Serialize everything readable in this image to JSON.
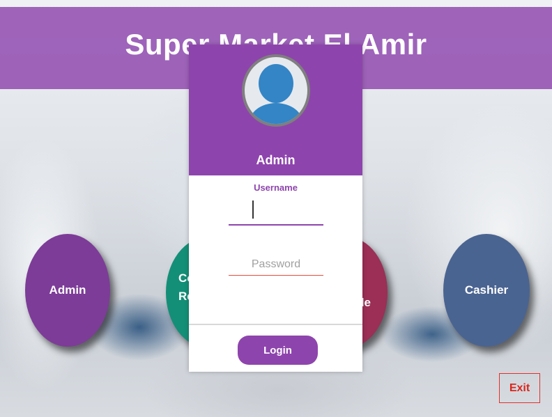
{
  "app": {
    "title": "Super Market El Amir"
  },
  "roles": [
    {
      "label_line1": "Admin",
      "label_line2": ""
    },
    {
      "label_line1": "Co",
      "label_line2": "Re"
    },
    {
      "label_line1": "",
      "label_line2": "le"
    },
    {
      "label_line1": "Cashier",
      "label_line2": ""
    }
  ],
  "login_card": {
    "role_title": "Admin",
    "username_label": "Username",
    "username_value": "",
    "password_placeholder": "Password",
    "login_label": "Login"
  },
  "footer": {
    "exit_label": "Exit"
  },
  "colors": {
    "accent": "#8e44ad",
    "admin": "#7d3c98",
    "commercial": "#148f77",
    "sale": "#9b2f55",
    "cashier": "#4a6491",
    "exit": "#d9261c"
  },
  "icons": {
    "avatar": "user-avatar-icon"
  }
}
